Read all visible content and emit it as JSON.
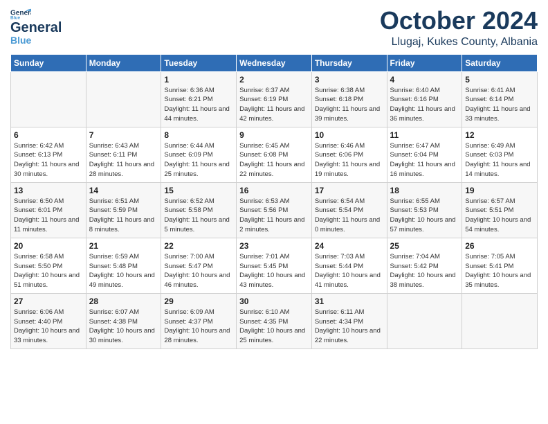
{
  "logo": {
    "line1": "General",
    "line2": "Blue"
  },
  "title": "October 2024",
  "location": "Llugaj, Kukes County, Albania",
  "days_of_week": [
    "Sunday",
    "Monday",
    "Tuesday",
    "Wednesday",
    "Thursday",
    "Friday",
    "Saturday"
  ],
  "weeks": [
    [
      {
        "num": "",
        "sunrise": "",
        "sunset": "",
        "daylight": ""
      },
      {
        "num": "",
        "sunrise": "",
        "sunset": "",
        "daylight": ""
      },
      {
        "num": "1",
        "sunrise": "Sunrise: 6:36 AM",
        "sunset": "Sunset: 6:21 PM",
        "daylight": "Daylight: 11 hours and 44 minutes."
      },
      {
        "num": "2",
        "sunrise": "Sunrise: 6:37 AM",
        "sunset": "Sunset: 6:19 PM",
        "daylight": "Daylight: 11 hours and 42 minutes."
      },
      {
        "num": "3",
        "sunrise": "Sunrise: 6:38 AM",
        "sunset": "Sunset: 6:18 PM",
        "daylight": "Daylight: 11 hours and 39 minutes."
      },
      {
        "num": "4",
        "sunrise": "Sunrise: 6:40 AM",
        "sunset": "Sunset: 6:16 PM",
        "daylight": "Daylight: 11 hours and 36 minutes."
      },
      {
        "num": "5",
        "sunrise": "Sunrise: 6:41 AM",
        "sunset": "Sunset: 6:14 PM",
        "daylight": "Daylight: 11 hours and 33 minutes."
      }
    ],
    [
      {
        "num": "6",
        "sunrise": "Sunrise: 6:42 AM",
        "sunset": "Sunset: 6:13 PM",
        "daylight": "Daylight: 11 hours and 30 minutes."
      },
      {
        "num": "7",
        "sunrise": "Sunrise: 6:43 AM",
        "sunset": "Sunset: 6:11 PM",
        "daylight": "Daylight: 11 hours and 28 minutes."
      },
      {
        "num": "8",
        "sunrise": "Sunrise: 6:44 AM",
        "sunset": "Sunset: 6:09 PM",
        "daylight": "Daylight: 11 hours and 25 minutes."
      },
      {
        "num": "9",
        "sunrise": "Sunrise: 6:45 AM",
        "sunset": "Sunset: 6:08 PM",
        "daylight": "Daylight: 11 hours and 22 minutes."
      },
      {
        "num": "10",
        "sunrise": "Sunrise: 6:46 AM",
        "sunset": "Sunset: 6:06 PM",
        "daylight": "Daylight: 11 hours and 19 minutes."
      },
      {
        "num": "11",
        "sunrise": "Sunrise: 6:47 AM",
        "sunset": "Sunset: 6:04 PM",
        "daylight": "Daylight: 11 hours and 16 minutes."
      },
      {
        "num": "12",
        "sunrise": "Sunrise: 6:49 AM",
        "sunset": "Sunset: 6:03 PM",
        "daylight": "Daylight: 11 hours and 14 minutes."
      }
    ],
    [
      {
        "num": "13",
        "sunrise": "Sunrise: 6:50 AM",
        "sunset": "Sunset: 6:01 PM",
        "daylight": "Daylight: 11 hours and 11 minutes."
      },
      {
        "num": "14",
        "sunrise": "Sunrise: 6:51 AM",
        "sunset": "Sunset: 5:59 PM",
        "daylight": "Daylight: 11 hours and 8 minutes."
      },
      {
        "num": "15",
        "sunrise": "Sunrise: 6:52 AM",
        "sunset": "Sunset: 5:58 PM",
        "daylight": "Daylight: 11 hours and 5 minutes."
      },
      {
        "num": "16",
        "sunrise": "Sunrise: 6:53 AM",
        "sunset": "Sunset: 5:56 PM",
        "daylight": "Daylight: 11 hours and 2 minutes."
      },
      {
        "num": "17",
        "sunrise": "Sunrise: 6:54 AM",
        "sunset": "Sunset: 5:54 PM",
        "daylight": "Daylight: 11 hours and 0 minutes."
      },
      {
        "num": "18",
        "sunrise": "Sunrise: 6:55 AM",
        "sunset": "Sunset: 5:53 PM",
        "daylight": "Daylight: 10 hours and 57 minutes."
      },
      {
        "num": "19",
        "sunrise": "Sunrise: 6:57 AM",
        "sunset": "Sunset: 5:51 PM",
        "daylight": "Daylight: 10 hours and 54 minutes."
      }
    ],
    [
      {
        "num": "20",
        "sunrise": "Sunrise: 6:58 AM",
        "sunset": "Sunset: 5:50 PM",
        "daylight": "Daylight: 10 hours and 51 minutes."
      },
      {
        "num": "21",
        "sunrise": "Sunrise: 6:59 AM",
        "sunset": "Sunset: 5:48 PM",
        "daylight": "Daylight: 10 hours and 49 minutes."
      },
      {
        "num": "22",
        "sunrise": "Sunrise: 7:00 AM",
        "sunset": "Sunset: 5:47 PM",
        "daylight": "Daylight: 10 hours and 46 minutes."
      },
      {
        "num": "23",
        "sunrise": "Sunrise: 7:01 AM",
        "sunset": "Sunset: 5:45 PM",
        "daylight": "Daylight: 10 hours and 43 minutes."
      },
      {
        "num": "24",
        "sunrise": "Sunrise: 7:03 AM",
        "sunset": "Sunset: 5:44 PM",
        "daylight": "Daylight: 10 hours and 41 minutes."
      },
      {
        "num": "25",
        "sunrise": "Sunrise: 7:04 AM",
        "sunset": "Sunset: 5:42 PM",
        "daylight": "Daylight: 10 hours and 38 minutes."
      },
      {
        "num": "26",
        "sunrise": "Sunrise: 7:05 AM",
        "sunset": "Sunset: 5:41 PM",
        "daylight": "Daylight: 10 hours and 35 minutes."
      }
    ],
    [
      {
        "num": "27",
        "sunrise": "Sunrise: 6:06 AM",
        "sunset": "Sunset: 4:40 PM",
        "daylight": "Daylight: 10 hours and 33 minutes."
      },
      {
        "num": "28",
        "sunrise": "Sunrise: 6:07 AM",
        "sunset": "Sunset: 4:38 PM",
        "daylight": "Daylight: 10 hours and 30 minutes."
      },
      {
        "num": "29",
        "sunrise": "Sunrise: 6:09 AM",
        "sunset": "Sunset: 4:37 PM",
        "daylight": "Daylight: 10 hours and 28 minutes."
      },
      {
        "num": "30",
        "sunrise": "Sunrise: 6:10 AM",
        "sunset": "Sunset: 4:35 PM",
        "daylight": "Daylight: 10 hours and 25 minutes."
      },
      {
        "num": "31",
        "sunrise": "Sunrise: 6:11 AM",
        "sunset": "Sunset: 4:34 PM",
        "daylight": "Daylight: 10 hours and 22 minutes."
      },
      {
        "num": "",
        "sunrise": "",
        "sunset": "",
        "daylight": ""
      },
      {
        "num": "",
        "sunrise": "",
        "sunset": "",
        "daylight": ""
      }
    ]
  ]
}
